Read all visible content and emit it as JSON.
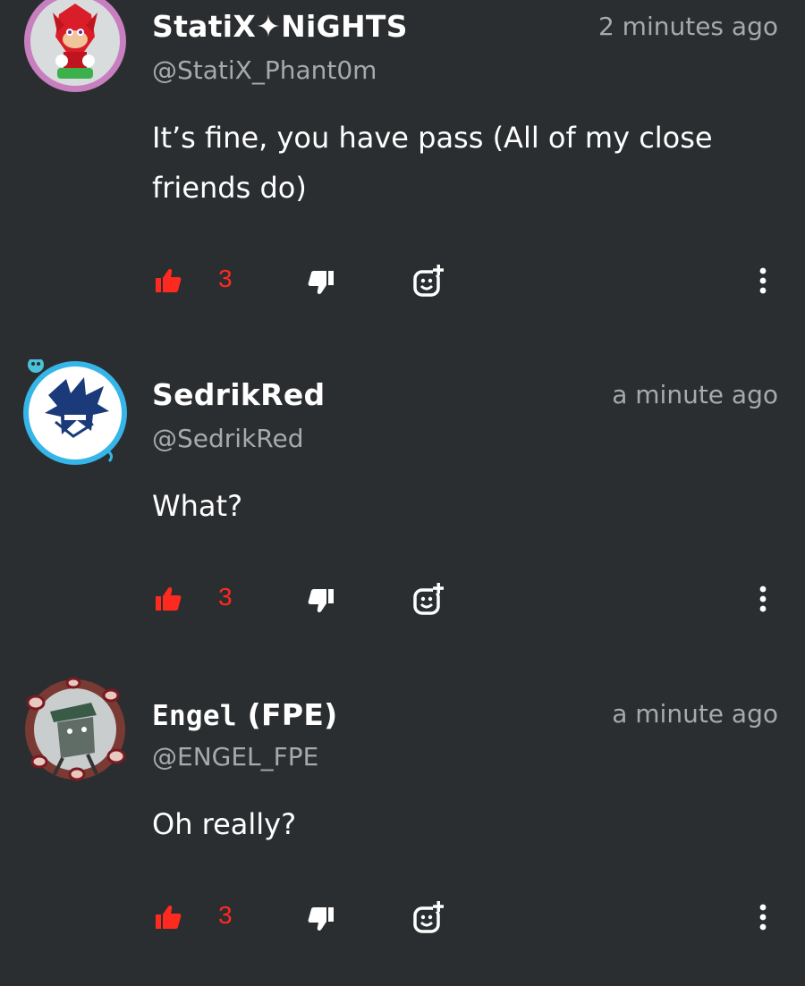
{
  "comments": [
    {
      "name": "StatiX✦NiGHTS",
      "handle": "@StatiX_Phant0m",
      "time": "2 minutes ago",
      "text": "It’s fine, you have pass (All of my close friends do)",
      "likes": "3"
    },
    {
      "name": "SedrikRed",
      "handle": "@SedrikRed",
      "time": "a minute ago",
      "text": "What?",
      "likes": "3"
    },
    {
      "name_mono": "Engel",
      "name_rest": " (FPE)",
      "handle": "@ENGEL_FPE",
      "time": "a minute ago",
      "text": "Oh really?",
      "likes": "3"
    }
  ],
  "icons": {
    "like": "thumbs-up-icon",
    "dislike": "thumbs-down-icon",
    "react": "add-reaction-icon",
    "more": "more-vertical-icon"
  },
  "colors": {
    "background": "#2b2e30",
    "like_active": "#ff2a1f",
    "secondary_text": "#a7aaac",
    "icon": "#ffffff"
  }
}
